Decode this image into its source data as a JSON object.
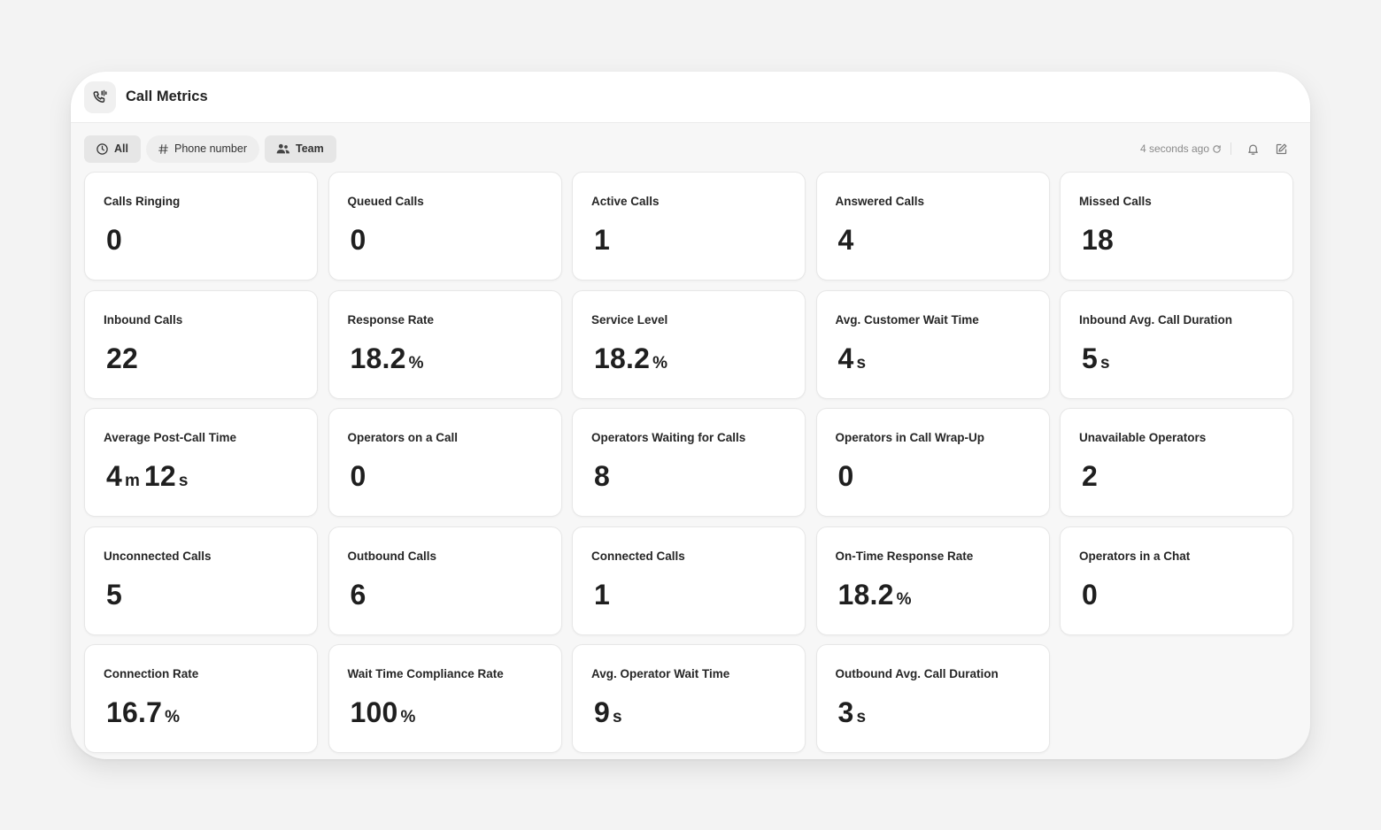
{
  "app": {
    "title": "Call Metrics",
    "icon": "phone-call-icon"
  },
  "filters": [
    {
      "label": "All",
      "icon": "clock-icon",
      "active": true
    },
    {
      "label": "Phone number",
      "icon": "hash-icon",
      "active": false
    },
    {
      "label": "Team",
      "icon": "users-icon",
      "active": false
    }
  ],
  "toolbar": {
    "updated": "4 seconds ago",
    "refresh_icon": "refresh-icon",
    "bell_icon": "bell-icon",
    "edit_icon": "edit-icon"
  },
  "metrics": [
    {
      "label": "Calls Ringing",
      "value": [
        {
          "n": "0"
        }
      ]
    },
    {
      "label": "Queued Calls",
      "value": [
        {
          "n": "0"
        }
      ]
    },
    {
      "label": "Active Calls",
      "value": [
        {
          "n": "1"
        }
      ]
    },
    {
      "label": "Answered Calls",
      "value": [
        {
          "n": "4"
        }
      ]
    },
    {
      "label": "Missed Calls",
      "value": [
        {
          "n": "18"
        }
      ]
    },
    {
      "label": "Inbound Calls",
      "value": [
        {
          "n": "22"
        }
      ]
    },
    {
      "label": "Response Rate",
      "value": [
        {
          "n": "18.2",
          "u": "%"
        }
      ]
    },
    {
      "label": "Service Level",
      "value": [
        {
          "n": "18.2",
          "u": "%"
        }
      ]
    },
    {
      "label": "Avg. Customer Wait Time",
      "value": [
        {
          "n": "4",
          "u": "s"
        }
      ]
    },
    {
      "label": "Inbound Avg. Call Duration",
      "value": [
        {
          "n": "5",
          "u": "s"
        }
      ]
    },
    {
      "label": "Average Post-Call Time",
      "value": [
        {
          "n": "4",
          "u": "m"
        },
        {
          "n": "12",
          "u": "s"
        }
      ]
    },
    {
      "label": "Operators on a Call",
      "value": [
        {
          "n": "0"
        }
      ]
    },
    {
      "label": "Operators Waiting for Calls",
      "value": [
        {
          "n": "8"
        }
      ]
    },
    {
      "label": "Operators in Call Wrap-Up",
      "value": [
        {
          "n": "0"
        }
      ]
    },
    {
      "label": "Unavailable Operators",
      "value": [
        {
          "n": "2"
        }
      ]
    },
    {
      "label": "Unconnected Calls",
      "value": [
        {
          "n": "5"
        }
      ]
    },
    {
      "label": "Outbound Calls",
      "value": [
        {
          "n": "6"
        }
      ]
    },
    {
      "label": "Connected Calls",
      "value": [
        {
          "n": "1"
        }
      ]
    },
    {
      "label": "On-Time Response Rate",
      "value": [
        {
          "n": "18.2",
          "u": "%"
        }
      ]
    },
    {
      "label": "Operators in a Chat",
      "value": [
        {
          "n": "0"
        }
      ]
    },
    {
      "label": "Connection Rate",
      "value": [
        {
          "n": "16.7",
          "u": "%"
        }
      ]
    },
    {
      "label": "Wait Time Compliance Rate",
      "value": [
        {
          "n": "100",
          "u": "%"
        }
      ]
    },
    {
      "label": "Avg. Operator Wait Time",
      "value": [
        {
          "n": "9",
          "u": "s"
        }
      ]
    },
    {
      "label": "Outbound Avg. Call Duration",
      "value": [
        {
          "n": "3",
          "u": "s"
        }
      ]
    }
  ]
}
